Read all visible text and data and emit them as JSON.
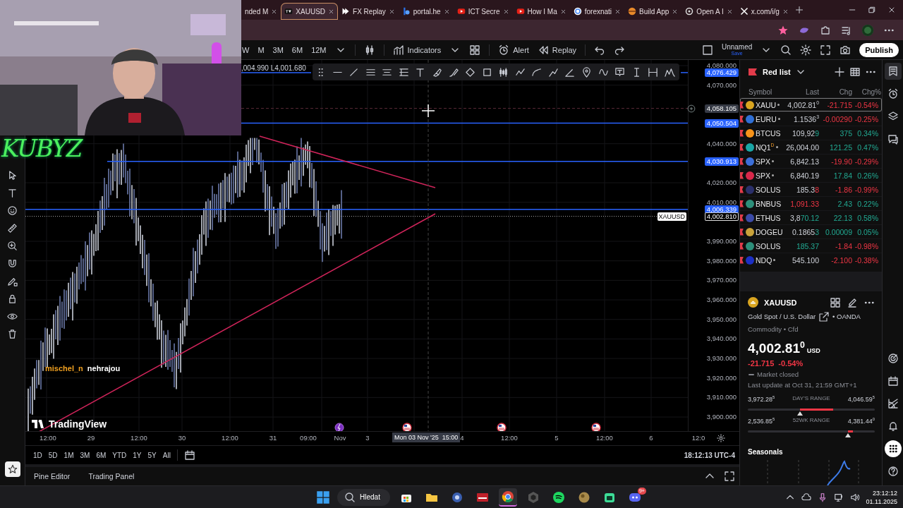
{
  "browser": {
    "tabs": [
      {
        "title": "nded M",
        "selected": false
      },
      {
        "title": "XAUUSD",
        "selected": true
      },
      {
        "title": "FX Replay",
        "selected": false
      },
      {
        "title": "portal.he",
        "selected": false
      },
      {
        "title": "ICT Secre",
        "selected": false
      },
      {
        "title": "How I Ma",
        "selected": false
      },
      {
        "title": "forexnati",
        "selected": false
      },
      {
        "title": "Build App",
        "selected": false
      },
      {
        "title": "Open A I",
        "selected": false
      },
      {
        "title": "x.com/i/g",
        "selected": false
      }
    ]
  },
  "toolbar": {
    "intervals": [
      "W",
      "M",
      "3M",
      "6M",
      "12M"
    ],
    "indicators": "Indicators",
    "alert": "Alert",
    "replay": "Replay",
    "layout_name": "Unnamed",
    "save": "Save",
    "publish": "Publish"
  },
  "chart": {
    "ohlc": ",004.990 L4,001.680",
    "price_ticks": [
      "4,080.000",
      "4,070.000",
      "4,040.000",
      "4,020.000",
      "4,010.000",
      "3,990.000",
      "3,980.000",
      "3,970.000",
      "3,960.000",
      "3,950.000",
      "3,940.000",
      "3,930.000",
      "3,920.000",
      "3,910.000",
      "3,900.000"
    ],
    "price_lines": [
      {
        "label": "4,076.429",
        "kind": "level"
      },
      {
        "label": "4,058.105",
        "kind": "crosshair"
      },
      {
        "label": "4,050.504",
        "kind": "level"
      },
      {
        "label": "4,030.913",
        "kind": "level"
      },
      {
        "label": "4,006.339",
        "kind": "level"
      },
      {
        "label": "4,002.810",
        "kind": "last",
        "symbol": "XAUUSD"
      }
    ],
    "time_ticks": [
      "12:00",
      "29",
      "12:00",
      "30",
      "12:00",
      "31",
      "09:00",
      "Nov",
      "3",
      "4",
      "12:00",
      "5",
      "12:00",
      "6",
      "12:0"
    ],
    "crosshair_time": "Mon 03 Nov '25  15:00",
    "events": [
      {
        "kind": "lightning"
      },
      {
        "kind": "flag"
      },
      {
        "kind": "flag"
      },
      {
        "kind": "flag"
      }
    ],
    "logo": "TradingView",
    "ranges": [
      "1D",
      "5D",
      "1M",
      "3M",
      "6M",
      "YTD",
      "1Y",
      "5Y",
      "All"
    ],
    "clock": "18:12:13 UTC-4"
  },
  "bottom_tabs": [
    "Pine Editor",
    "Trading Panel"
  ],
  "overlay": {
    "channel": "KUBYZ",
    "chat": [
      {
        "user": "mischel_n",
        "message": "nehrajou"
      }
    ]
  },
  "watchlist": {
    "title": "Red list",
    "columns": [
      "Symbol",
      "Last",
      "Chg",
      "Chg%"
    ],
    "rows": [
      {
        "symbol": "XAUU",
        "color": "#d9a520",
        "market_dot": true,
        "last": "4,002.81$^{0}$",
        "chg": "-21.715",
        "chg_pct": "-0.54%",
        "rising": false,
        "selected": true
      },
      {
        "symbol": "EURU",
        "color": "#2f6fd6",
        "market_dot": true,
        "last": "1.1536$^{3}$",
        "chg": "-0.00290",
        "chg_pct": "-0.25%",
        "rising": false,
        "selected": false
      },
      {
        "symbol": "BTCUS",
        "color": "#f7931a",
        "market_dot": false,
        "last": "109,92",
        "last_tail": "9",
        "tail_rising": true,
        "chg": "375",
        "chg_pct": "0.34%",
        "rising": true,
        "selected": false
      },
      {
        "symbol": "NQ1$^{D}$",
        "color": "#1aa6a6",
        "market_dot": true,
        "last": "26,004.00",
        "chg": "121.25",
        "chg_pct": "0.47%",
        "rising": true,
        "selected": false
      },
      {
        "symbol": "SPX",
        "color": "#3c6fd8",
        "market_dot": true,
        "last": "6,842.13",
        "chg": "-19.90",
        "chg_pct": "-0.29%",
        "rising": false,
        "selected": false
      },
      {
        "symbol": "SPX",
        "color": "#d8284a",
        "market_dot": true,
        "last": "6,840.19",
        "chg": "17.84",
        "chg_pct": "0.26%",
        "rising": true,
        "selected": false
      },
      {
        "symbol": "SOLUS",
        "color": "#2a2f6a",
        "market_dot": false,
        "last": "185.3",
        "last_tail": "8",
        "tail_rising": false,
        "chg": "-1.86",
        "chg_pct": "-0.99%",
        "rising": false,
        "selected": false
      },
      {
        "symbol": "BNBUS",
        "color": "#2d8f7a",
        "market_dot": false,
        "last_tail": "1,091.33",
        "tail_rising": false,
        "chg": "2.43",
        "chg_pct": "0.22%",
        "rising": true,
        "selected": false
      },
      {
        "symbol": "ETHUS",
        "color": "#3b4aa8",
        "market_dot": false,
        "last": "3,8",
        "last_tail": "70.12",
        "tail_rising": true,
        "chg": "22.13",
        "chg_pct": "0.58%",
        "rising": true,
        "selected": false
      },
      {
        "symbol": "DOGEU",
        "color": "#c9a23a",
        "market_dot": false,
        "last": "0.1865",
        "last_tail": "3",
        "tail_rising": true,
        "chg": "0.00009",
        "chg_pct": "0.05%",
        "rising": true,
        "selected": false
      },
      {
        "symbol": "SOLUS",
        "color": "#2d8f7a",
        "market_dot": false,
        "last_tail": "185.37",
        "tail_rising": true,
        "chg": "-1.84",
        "chg_pct": "-0.98%",
        "rising": false,
        "selected": false
      },
      {
        "symbol": "NDQ",
        "color": "#1c2fc4",
        "market_dot": true,
        "last": "545.100",
        "chg": "-2.100",
        "chg_pct": "-0.38%",
        "rising": false,
        "selected": false
      }
    ]
  },
  "details": {
    "symbol": "XAUUSD",
    "name": "Gold Spot / U.S. Dollar",
    "exchange": "• OANDA",
    "category": "Commodity • Cfd",
    "price": "4,002.81$^{0}$",
    "currency": "USD",
    "change": "-21.715",
    "change_pct": "-0.54%",
    "rising": false,
    "status": "Market closed",
    "updated": "Last update at Oct 31, 21:59 GMT+1",
    "ranges": [
      {
        "low": "3,972.28$^{5}$",
        "label": "DAY'S RANGE",
        "high": "4,046.59$^{5}$",
        "marker": {
          "level": 0.41
        },
        "fill": {
          "level": 0.67
        }
      },
      {
        "low": "2,536.85$^{5}$",
        "label": "52WK RANGE",
        "high": "4,381.44$^{0}$",
        "marker": {
          "level": 0.79
        },
        "fill": {
          "level": 0.83
        }
      }
    ],
    "seasonals": "Seasonals"
  },
  "side_strip": {
    "top": [
      {
        "selected": true
      },
      {
        "selected": false
      },
      {
        "selected": false
      },
      {
        "selected": false
      }
    ],
    "bottom": [
      {
        "selected": false
      },
      {
        "selected": false
      },
      {
        "selected": false
      },
      {
        "selected": false
      },
      {
        "selected": true
      },
      {
        "selected": false
      }
    ]
  },
  "taskbar": {
    "search": "Hledat",
    "apps": [
      {
        "selected": false
      },
      {
        "selected": false
      },
      {
        "selected": false
      },
      {
        "selected": false
      },
      {
        "selected": true
      },
      {
        "selected": false
      },
      {
        "selected": false
      },
      {
        "selected": false
      },
      {
        "selected": false
      },
      {
        "selected": false,
        "badge": "9+"
      }
    ],
    "time": "23:12:12",
    "date": "01.11.2025"
  }
}
